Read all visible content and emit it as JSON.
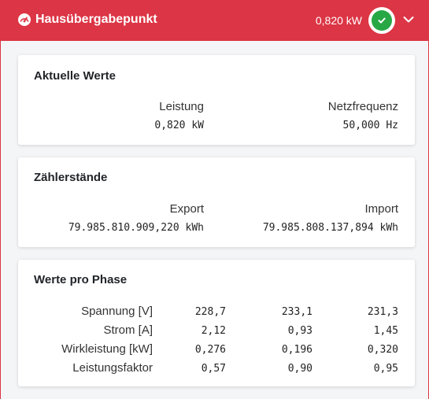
{
  "header": {
    "title": "Hausübergabepunkt",
    "power": "0,820 kW",
    "status_color": "#28a745",
    "accent_color": "#dc3545",
    "gauge_icon": "tachometer-icon",
    "status_icon": "check-circle-icon",
    "toggle_icon": "chevron-down-icon"
  },
  "current": {
    "title": "Aktuelle Werte",
    "power_label": "Leistung",
    "power_value": "0,820 kW",
    "freq_label": "Netzfrequenz",
    "freq_value": "50,000 Hz"
  },
  "meters": {
    "title": "Zählerstände",
    "export_label": "Export",
    "export_value": "79.985.810.909,220 kWh",
    "import_label": "Import",
    "import_value": "79.985.808.137,894 kWh"
  },
  "phases": {
    "title": "Werte pro Phase",
    "rows": [
      {
        "label": "Spannung [V]",
        "values": [
          "228,7",
          "233,1",
          "231,3"
        ]
      },
      {
        "label": "Strom [A]",
        "values": [
          "2,12",
          "0,93",
          "1,45"
        ]
      },
      {
        "label": "Wirkleistung [kW]",
        "values": [
          "0,276",
          "0,196",
          "0,320"
        ]
      },
      {
        "label": "Leistungsfaktor",
        "values": [
          "0,57",
          "0,90",
          "0,95"
        ]
      }
    ]
  }
}
